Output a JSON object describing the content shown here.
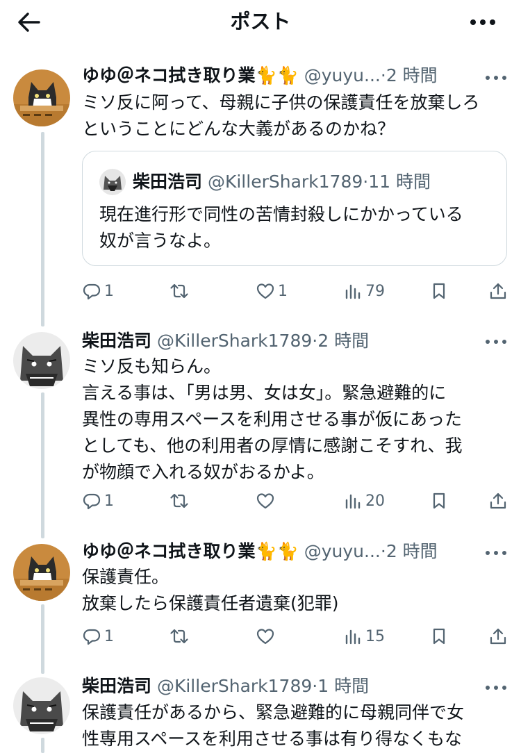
{
  "header": {
    "title": "ポスト",
    "back_icon": "arrow-left-icon",
    "more_icon": "more-horizontal-icon"
  },
  "colors": {
    "text": "#0f1419",
    "secondary": "#536471",
    "border": "#cfd9de",
    "background": "#ffffff"
  },
  "posts": [
    {
      "name": "ゆゆ＠ネコ拭き取り業",
      "emoji": "🐈🐈",
      "handle": "@yuyu...",
      "dot": "·",
      "time": "2 時間",
      "lines": [
        "ミソ反に阿って、母親に子供の保護責任を放棄しろ",
        "ということにどんな大義があるのかね？"
      ],
      "quote": {
        "name": "柴田浩司",
        "handle": "@KillerShark1789",
        "dot": "·",
        "time": "11 時間",
        "lines": [
          "現在進行形で同性の苦情封殺しにかかっている",
          "奴が言うなよ。"
        ]
      },
      "stats": {
        "replies": "1",
        "reposts": "",
        "likes": "1",
        "views": "79"
      }
    },
    {
      "name": "柴田浩司",
      "handle": "@KillerShark1789",
      "dot": "·",
      "time": "2 時間",
      "lines": [
        "ミソ反も知らん。",
        "言える事は、「男は男、女は女」。緊急避難的に",
        "異性の専用スペースを利用させる事が仮にあった",
        "としても、他の利用者の厚情に感謝こそすれ、我",
        "が物顔で入れる奴がおるかよ。"
      ],
      "stats": {
        "replies": "1",
        "reposts": "",
        "likes": "",
        "views": "20"
      }
    },
    {
      "name": "ゆゆ＠ネコ拭き取り業",
      "emoji": "🐈🐈",
      "handle": "@yuyu...",
      "dot": "·",
      "time": "2 時間",
      "lines": [
        "保護責任。",
        "放棄したら保護責任者遺棄(犯罪)"
      ],
      "stats": {
        "replies": "1",
        "reposts": "",
        "likes": "",
        "views": "15"
      }
    },
    {
      "name": "柴田浩司",
      "handle": "@KillerShark1789",
      "dot": "·",
      "time": "1 時間",
      "lines": [
        "保護責任があるから、緊急避難的に母親同伴で女",
        "性専用スペースを利用させる事は有り得なくもな"
      ]
    }
  ]
}
